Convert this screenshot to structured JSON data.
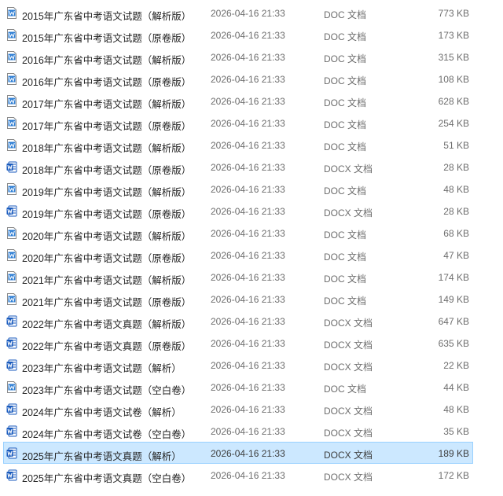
{
  "files": [
    {
      "name": "2015年广东省中考语文试题（解析版）",
      "date": "2026-04-16 21:33",
      "type": "DOC 文档",
      "size": "773 KB",
      "icon": "word-doc-icon"
    },
    {
      "name": "2015年广东省中考语文试题（原卷版）",
      "date": "2026-04-16 21:33",
      "type": "DOC 文档",
      "size": "173 KB",
      "icon": "word-doc-icon"
    },
    {
      "name": "2016年广东省中考语文试题（解析版）",
      "date": "2026-04-16 21:33",
      "type": "DOC 文档",
      "size": "315 KB",
      "icon": "word-doc-icon"
    },
    {
      "name": "2016年广东省中考语文试题（原卷版）",
      "date": "2026-04-16 21:33",
      "type": "DOC 文档",
      "size": "108 KB",
      "icon": "word-doc-icon"
    },
    {
      "name": "2017年广东省中考语文试题（解析版）",
      "date": "2026-04-16 21:33",
      "type": "DOC 文档",
      "size": "628 KB",
      "icon": "word-doc-icon"
    },
    {
      "name": "2017年广东省中考语文试题（原卷版）",
      "date": "2026-04-16 21:33",
      "type": "DOC 文档",
      "size": "254 KB",
      "icon": "word-doc-icon"
    },
    {
      "name": "2018年广东省中考语文试题（解析版）",
      "date": "2026-04-16 21:33",
      "type": "DOC 文档",
      "size": "51 KB",
      "icon": "word-doc-icon"
    },
    {
      "name": "2018年广东省中考语文试题（原卷版）",
      "date": "2026-04-16 21:33",
      "type": "DOCX 文档",
      "size": "28 KB",
      "icon": "word-docx-icon"
    },
    {
      "name": "2019年广东省中考语文试题（解析版）",
      "date": "2026-04-16 21:33",
      "type": "DOC 文档",
      "size": "48 KB",
      "icon": "word-doc-icon"
    },
    {
      "name": "2019年广东省中考语文试题（原卷版）",
      "date": "2026-04-16 21:33",
      "type": "DOCX 文档",
      "size": "28 KB",
      "icon": "word-docx-icon"
    },
    {
      "name": "2020年广东省中考语文试题（解析版）",
      "date": "2026-04-16 21:33",
      "type": "DOC 文档",
      "size": "68 KB",
      "icon": "word-doc-icon"
    },
    {
      "name": "2020年广东省中考语文试题（原卷版）",
      "date": "2026-04-16 21:33",
      "type": "DOC 文档",
      "size": "47 KB",
      "icon": "word-doc-icon"
    },
    {
      "name": "2021年广东省中考语文试题（解析版）",
      "date": "2026-04-16 21:33",
      "type": "DOC 文档",
      "size": "174 KB",
      "icon": "word-doc-icon"
    },
    {
      "name": "2021年广东省中考语文试题（原卷版）",
      "date": "2026-04-16 21:33",
      "type": "DOC 文档",
      "size": "149 KB",
      "icon": "word-doc-icon"
    },
    {
      "name": "2022年广东省中考语文真题（解析版）",
      "date": "2026-04-16 21:33",
      "type": "DOCX 文档",
      "size": "647 KB",
      "icon": "word-docx-icon"
    },
    {
      "name": "2022年广东省中考语文真题（原卷版）",
      "date": "2026-04-16 21:33",
      "type": "DOCX 文档",
      "size": "635 KB",
      "icon": "word-docx-icon"
    },
    {
      "name": "2023年广东省中考语文试题（解析）",
      "date": "2026-04-16 21:33",
      "type": "DOCX 文档",
      "size": "22 KB",
      "icon": "word-docx-icon"
    },
    {
      "name": "2023年广东省中考语文试题（空白卷）",
      "date": "2026-04-16 21:33",
      "type": "DOC 文档",
      "size": "44 KB",
      "icon": "word-doc-icon"
    },
    {
      "name": "2024年广东省中考语文试卷（解析）",
      "date": "2026-04-16 21:33",
      "type": "DOCX 文档",
      "size": "48 KB",
      "icon": "word-docx-icon"
    },
    {
      "name": "2024年广东省中考语文试卷（空白卷）",
      "date": "2026-04-16 21:33",
      "type": "DOCX 文档",
      "size": "35 KB",
      "icon": "word-docx-icon"
    },
    {
      "name": "2025年广东省中考语文真题（解析）",
      "date": "2026-04-16 21:33",
      "type": "DOCX 文档",
      "size": "189 KB",
      "icon": "word-docx-icon",
      "selected": true
    },
    {
      "name": "2025年广东省中考语文真题（空白卷）",
      "date": "2026-04-16 21:33",
      "type": "DOCX 文档",
      "size": "172 KB",
      "icon": "word-docx-icon"
    }
  ],
  "colors": {
    "doc_icon": "#2b7cd3",
    "docx_icon": "#185abd",
    "selection_bg": "#cce8ff",
    "selection_border": "#99d1ff",
    "meta_text": "#6d6d6d"
  }
}
